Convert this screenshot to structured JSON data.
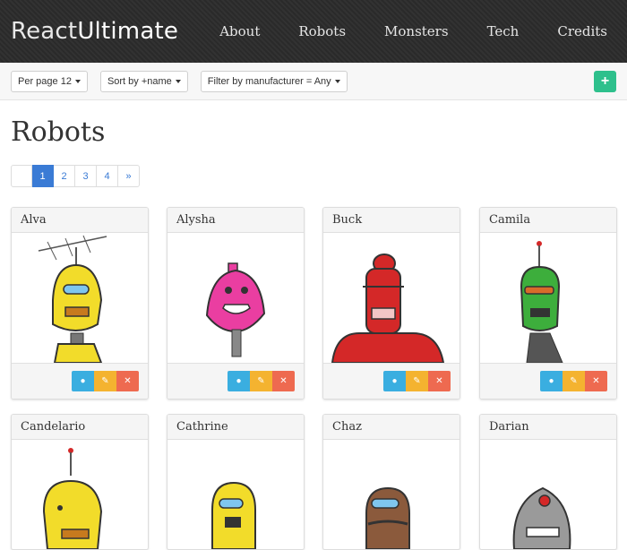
{
  "brand": {
    "light": "React",
    "bold": "Ultimate"
  },
  "nav": [
    "About",
    "Robots",
    "Monsters",
    "Tech",
    "Credits"
  ],
  "toolbar": {
    "per_page": "Per page 12",
    "sort": "Sort by +name",
    "filter": "Filter by manufacturer = Any",
    "add_label": "+"
  },
  "page_title": "Robots",
  "pagination": {
    "prev": "",
    "pages": [
      "1",
      "2",
      "3",
      "4"
    ],
    "next": "»",
    "active": "1"
  },
  "robots": [
    {
      "name": "Alva",
      "color": "#f2dc2a"
    },
    {
      "name": "Alysha",
      "color": "#ea3ea1"
    },
    {
      "name": "Buck",
      "color": "#d42828"
    },
    {
      "name": "Camila",
      "color": "#3dae3c"
    },
    {
      "name": "Candelario",
      "color": "#f2dc2a"
    },
    {
      "name": "Cathrine",
      "color": "#f2dc2a"
    },
    {
      "name": "Chaz",
      "color": "#8b5a3c"
    },
    {
      "name": "Darian",
      "color": "#9a9a9a"
    }
  ],
  "actions": {
    "view_icon": "eye-icon",
    "edit_icon": "edit-icon",
    "delete_icon": "close-icon"
  },
  "colors": {
    "view": "#3aaee0",
    "edit": "#f4b330",
    "delete": "#ee6a50",
    "add": "#2ec08c",
    "active_page": "#3a7bd5"
  }
}
